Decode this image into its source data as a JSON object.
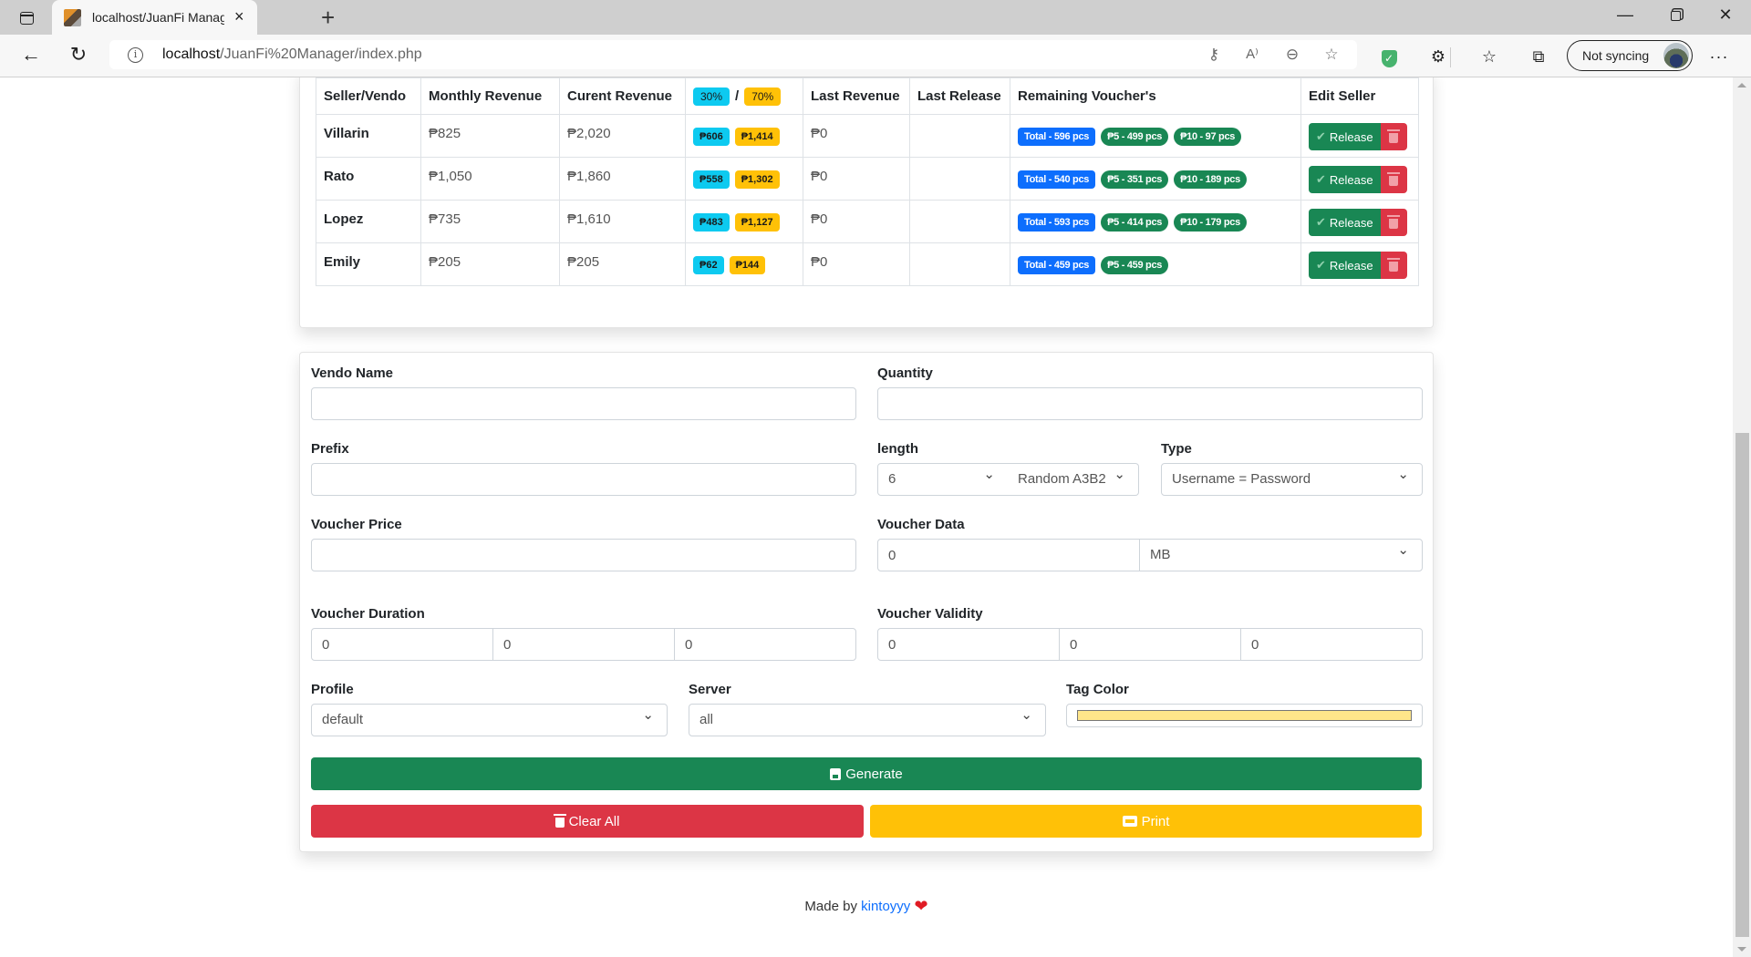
{
  "browser": {
    "tab_title": "localhost/JuanFi Manager/index.php",
    "tab_close": "×",
    "new_tab": "+",
    "url_host": "localhost",
    "url_path": "/JuanFi%20Manager/index.php",
    "sync_label": "Not syncing",
    "more": "···"
  },
  "table": {
    "headers": {
      "seller": "Seller/Vendo",
      "monthly": "Monthly Revenue",
      "current": "Curent Revenue",
      "split_a": "30%",
      "split_sep": "/",
      "split_b": "70%",
      "last_revenue": "Last Revenue",
      "last_release": "Last Release",
      "remaining": "Remaining Voucher's",
      "edit": "Edit Seller"
    },
    "rows": [
      {
        "name": "Villarin",
        "monthly": "₱825",
        "current": "₱2,020",
        "share_a": "₱606",
        "share_b": "₱1,414",
        "last_revenue": "₱0",
        "last_release": "",
        "total": "Total - 596 pcs",
        "v5": "₱5 - 499 pcs",
        "v10": "₱10 - 97 pcs",
        "release": "Release"
      },
      {
        "name": "Rato",
        "monthly": "₱1,050",
        "current": "₱1,860",
        "share_a": "₱558",
        "share_b": "₱1,302",
        "last_revenue": "₱0",
        "last_release": "",
        "total": "Total - 540 pcs",
        "v5": "₱5 - 351 pcs",
        "v10": "₱10 - 189 pcs",
        "release": "Release"
      },
      {
        "name": "Lopez",
        "monthly": "₱735",
        "current": "₱1,610",
        "share_a": "₱483",
        "share_b": "₱1,127",
        "last_revenue": "₱0",
        "last_release": "",
        "total": "Total - 593 pcs",
        "v5": "₱5 - 414 pcs",
        "v10": "₱10 - 179 pcs",
        "release": "Release"
      },
      {
        "name": "Emily",
        "monthly": "₱205",
        "current": "₱205",
        "share_a": "₱62",
        "share_b": "₱144",
        "last_revenue": "₱0",
        "last_release": "",
        "total": "Total - 459 pcs",
        "v5": "₱5 - 459 pcs",
        "v10": null,
        "release": "Release"
      }
    ]
  },
  "form": {
    "vendo_name": {
      "label": "Vendo Name",
      "value": ""
    },
    "quantity": {
      "label": "Quantity",
      "value": ""
    },
    "prefix": {
      "label": "Prefix",
      "value": ""
    },
    "length": {
      "label": "length",
      "value": "6",
      "charset": "Random A3B2"
    },
    "type": {
      "label": "Type",
      "value": "Username = Password"
    },
    "voucher_price": {
      "label": "Voucher Price",
      "value": ""
    },
    "voucher_data": {
      "label": "Voucher Data",
      "value": "0",
      "unit": "MB"
    },
    "voucher_duration": {
      "label": "Voucher Duration",
      "values": [
        "0",
        "0",
        "0"
      ]
    },
    "voucher_validity": {
      "label": "Voucher Validity",
      "values": [
        "0",
        "0",
        "0"
      ]
    },
    "profile": {
      "label": "Profile",
      "value": "default"
    },
    "server": {
      "label": "Server",
      "value": "all"
    },
    "tag_color": {
      "label": "Tag Color",
      "value": "#ffe68a"
    },
    "generate": "Generate",
    "clear_all": "Clear All",
    "print": "Print"
  },
  "footer": {
    "prefix": "Made by",
    "author": "kintoyyy",
    "heart": "❤"
  }
}
